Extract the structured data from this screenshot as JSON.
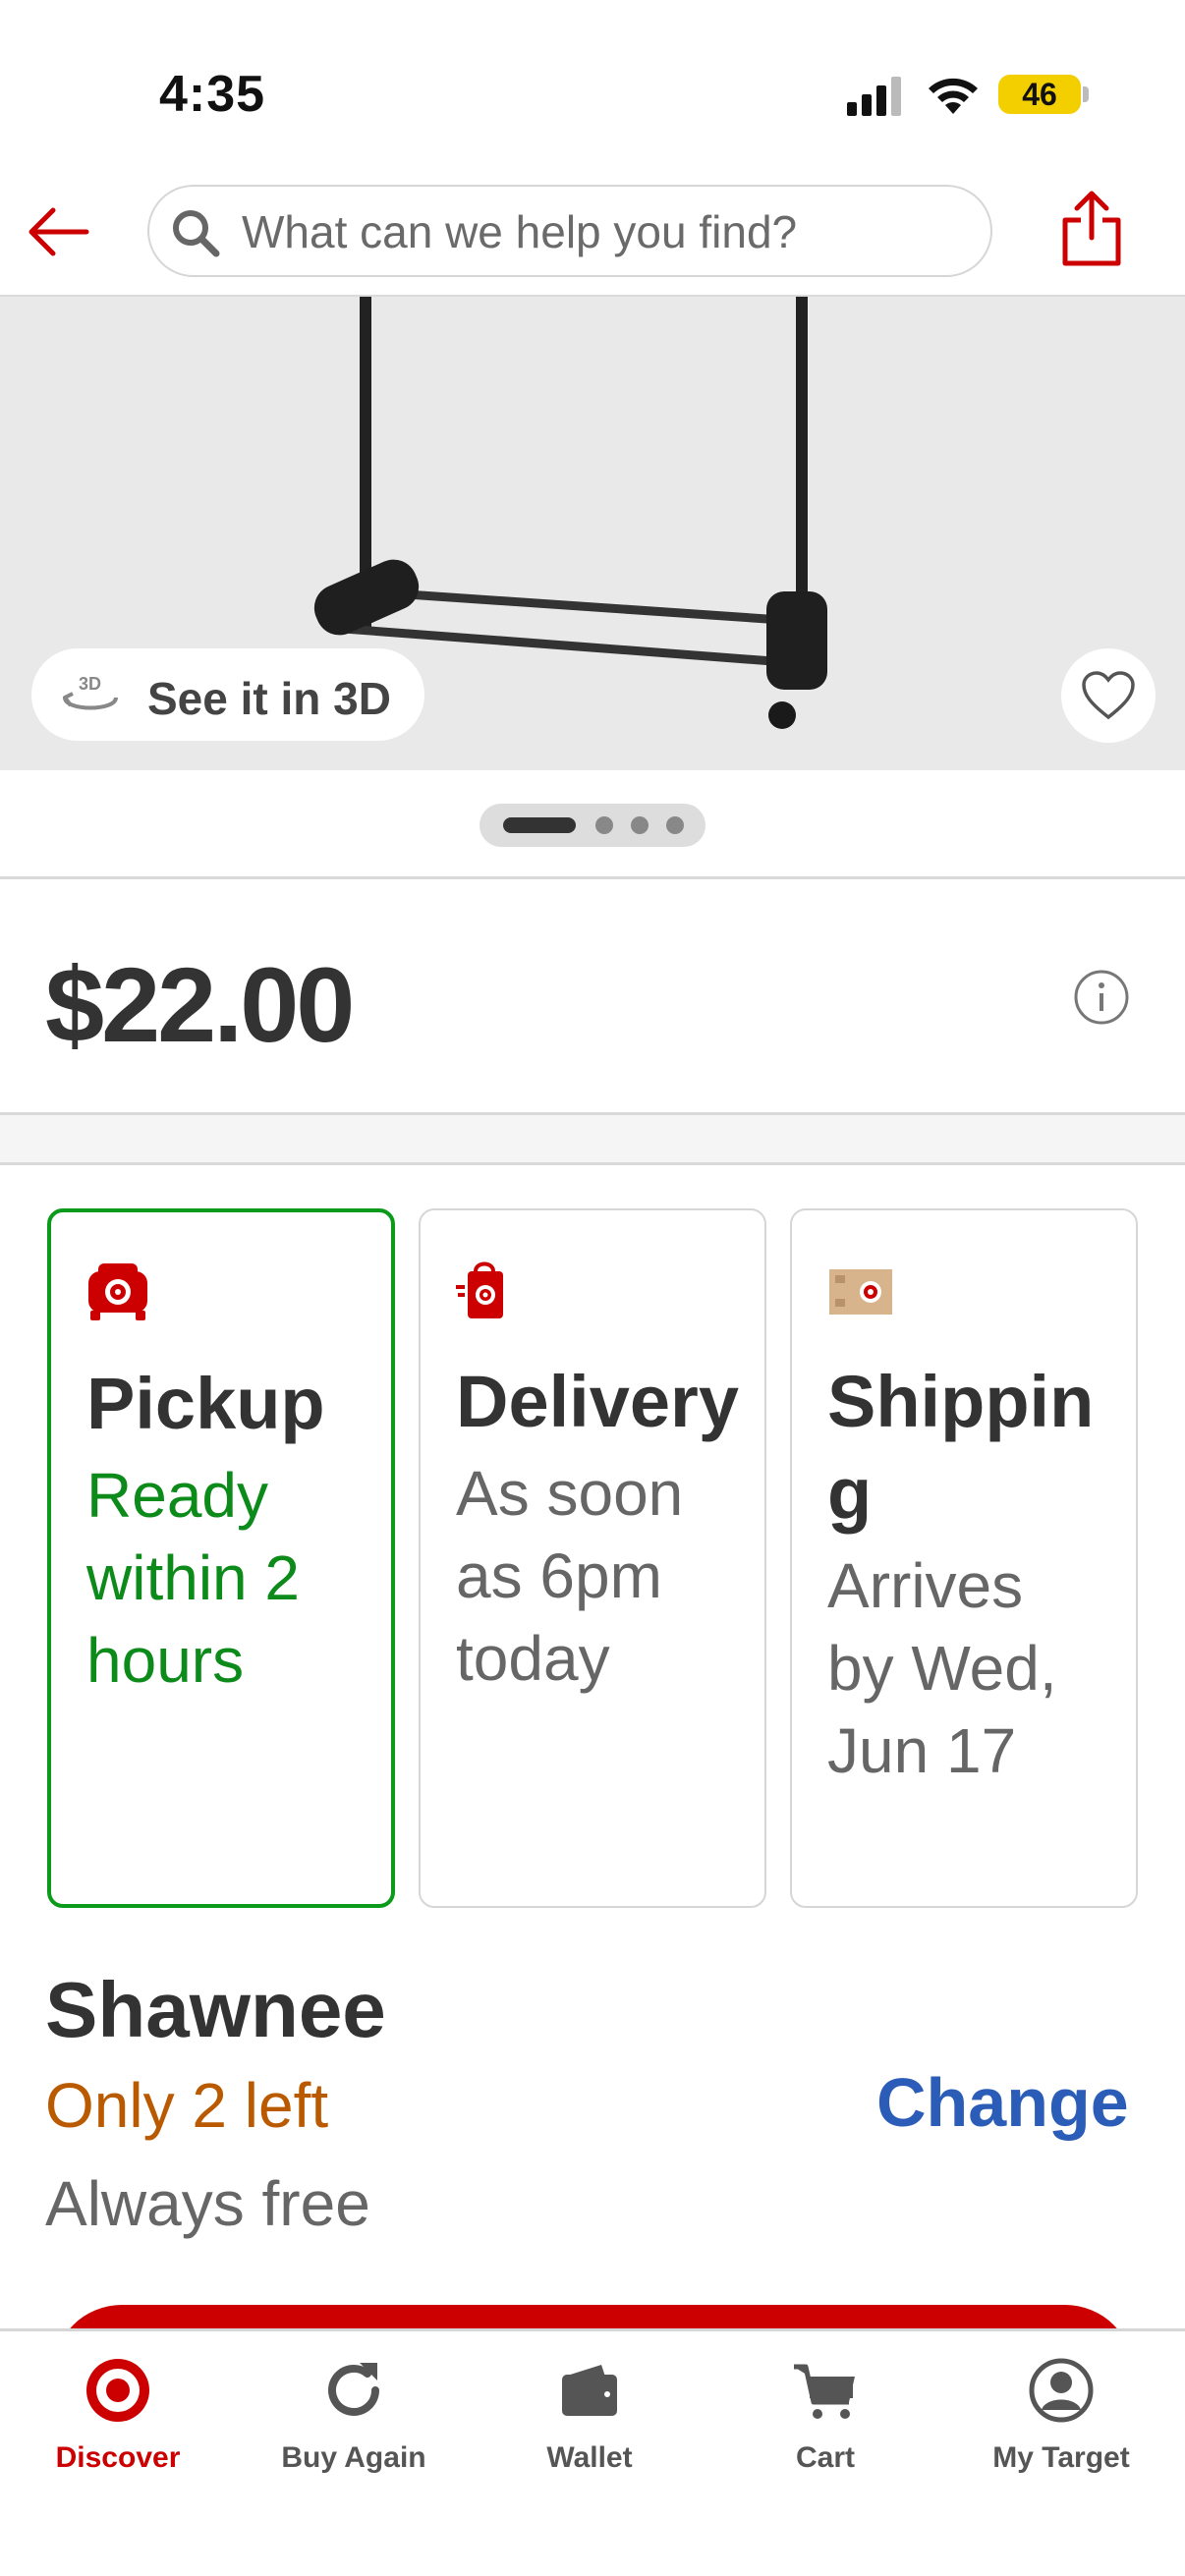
{
  "status_bar": {
    "time": "4:35",
    "battery": "46"
  },
  "search": {
    "placeholder": "What can we help you find?"
  },
  "product": {
    "see_3d_label": "See it in 3D",
    "price": "$22.00"
  },
  "fulfillment": [
    {
      "title": "Pickup",
      "subtitle": "Ready within 2 hours",
      "icon": "car-icon",
      "selected": true
    },
    {
      "title": "Delivery",
      "subtitle": "As soon as 6pm today",
      "icon": "shopping-bag-icon",
      "selected": false
    },
    {
      "title": "Shipping",
      "subtitle": "Arrives by Wed, Jun 17",
      "icon": "box-icon",
      "selected": false
    }
  ],
  "store": {
    "name": "Shawnee",
    "stock": "Only 2 left",
    "change_label": "Change",
    "shipping_cost": "Always free"
  },
  "nav": [
    {
      "label": "Discover",
      "icon": "target-logo-icon",
      "active": true
    },
    {
      "label": "Buy Again",
      "icon": "refresh-icon",
      "active": false
    },
    {
      "label": "Wallet",
      "icon": "wallet-icon",
      "active": false
    },
    {
      "label": "Cart",
      "icon": "cart-icon",
      "active": false
    },
    {
      "label": "My Target",
      "icon": "user-icon",
      "active": false
    }
  ],
  "colors": {
    "brand_red": "#cc0000",
    "selected_green": "#0c9a1a",
    "stock_orange": "#b95a00",
    "link_blue": "#2a5cb8"
  }
}
